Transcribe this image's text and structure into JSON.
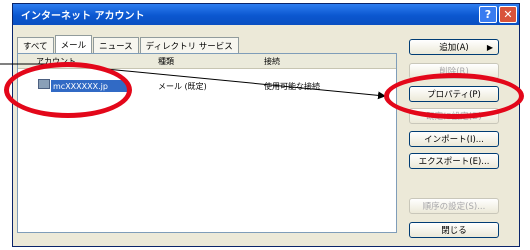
{
  "window": {
    "title": "インターネット アカウント"
  },
  "tabs": [
    "すべて",
    "メール",
    "ニュース",
    "ディレクトリ サービス"
  ],
  "columns": {
    "account": "アカウント",
    "type": "種類",
    "connection": "接続"
  },
  "account_row": {
    "name": "mcXXXXXX.jp",
    "type": "メール (既定)",
    "connection": "使用可能な接続"
  },
  "buttons": {
    "add": "追加(A)",
    "remove": "削除(R)",
    "properties": "プロパティ(P)",
    "set_default": "既定に設定(D)",
    "import": "インポート(I)...",
    "export": "エクスポート(E)...",
    "set_order": "順序の設定(S)...",
    "close": "閉じる"
  },
  "colors": {
    "annotation": "#e3071a",
    "titlebar": "#0b57d0"
  },
  "icons": {
    "help": "?",
    "close": "✕",
    "add_arrow": "▶"
  }
}
